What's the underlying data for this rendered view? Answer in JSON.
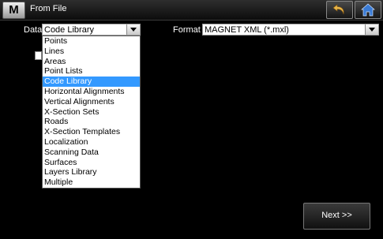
{
  "window": {
    "title": "From File"
  },
  "header": {
    "logo": "M",
    "back_icon": "undo-arrow-icon",
    "home_icon": "home-icon"
  },
  "data_field": {
    "label": "Data",
    "value": "Code Library",
    "options": [
      "Points",
      "Lines",
      "Areas",
      "Point Lists",
      "Code Library",
      "Horizontal Alignments",
      "Vertical Alignments",
      "X-Section Sets",
      "Roads",
      "X-Section Templates",
      "Localization",
      "Scanning Data",
      "Surfaces",
      "Layers Library",
      "Multiple"
    ],
    "selected_option": "Code Library"
  },
  "format_field": {
    "label": "Format",
    "value": "MAGNET XML (*.mxl)"
  },
  "footer": {
    "next_label": "Next >>"
  },
  "colors": {
    "selection": "#3399ff",
    "background": "#000000",
    "home_icon": "#3a7bd5",
    "back_icon": "#e8b64a"
  }
}
